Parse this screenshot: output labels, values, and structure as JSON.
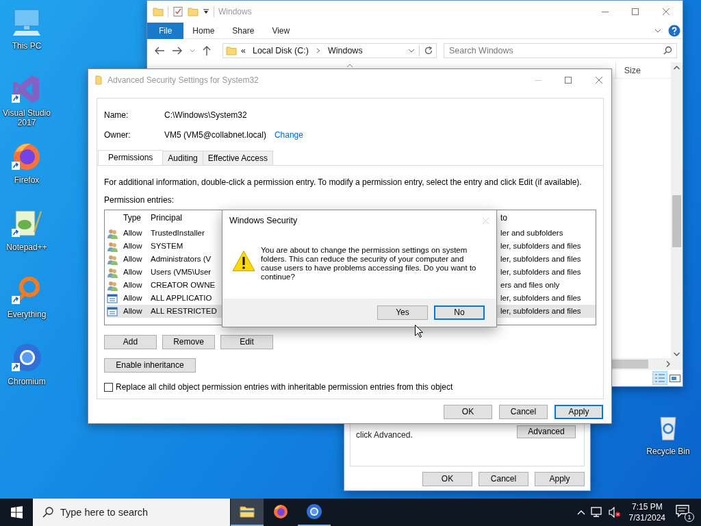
{
  "desktop_icons": [
    {
      "kind": "pc",
      "label": "This PC",
      "shortcut": false
    },
    {
      "kind": "vs",
      "label": "Visual Studio 2017",
      "shortcut": true
    },
    {
      "kind": "firefox",
      "label": "Firefox",
      "shortcut": true
    },
    {
      "kind": "notepad",
      "label": "Notepad++",
      "shortcut": true
    },
    {
      "kind": "everything",
      "label": "Everything",
      "shortcut": true
    },
    {
      "kind": "chromium",
      "label": "Chromium",
      "shortcut": true
    }
  ],
  "recycle_bin": {
    "label": "Recycle Bin"
  },
  "explorer": {
    "title": "Windows",
    "ribbon_tabs": [
      {
        "label": "File",
        "selected": true
      },
      {
        "label": "Home",
        "selected": false
      },
      {
        "label": "Share",
        "selected": false
      },
      {
        "label": "View",
        "selected": false
      }
    ],
    "address": {
      "overflow": "«",
      "crumbs": [
        "Local Disk (C:)",
        "Windows"
      ]
    },
    "search": {
      "placeholder": "Search Windows"
    },
    "columns": [
      "Size"
    ]
  },
  "properties_window": {
    "note": "click Advanced.",
    "advanced_button": "Advanced",
    "buttons": [
      "OK",
      "Cancel",
      "Apply"
    ]
  },
  "advanced_window": {
    "title": "Advanced Security Settings for System32",
    "name_label": "Name:",
    "name": "C:\\Windows\\System32",
    "owner_label": "Owner:",
    "owner": "VM5 (VM5@collabnet.local)",
    "owner_link": "Change",
    "tabs": [
      {
        "label": "Permissions",
        "selected": true
      },
      {
        "label": "Auditing",
        "selected": false
      },
      {
        "label": "Effective Access",
        "selected": false
      }
    ],
    "info": "For additional information, double-click a permission entry. To modify a permission entry, select the entry and click Edit (if available).",
    "entries_label": "Permission entries:",
    "columns": [
      "Type",
      "Principal",
      "to"
    ],
    "rows": [
      {
        "kind": "user",
        "type": "Allow",
        "principal": "TrustedInstaller",
        "applies_to": "ler and subfolders",
        "selected": false
      },
      {
        "kind": "user",
        "type": "Allow",
        "principal": "SYSTEM",
        "applies_to": "ler, subfolders and files",
        "selected": false
      },
      {
        "kind": "user",
        "type": "Allow",
        "principal": "Administrators (V",
        "applies_to": "ler, subfolders and files",
        "selected": false
      },
      {
        "kind": "user",
        "type": "Allow",
        "principal": "Users (VM5\\User",
        "applies_to": "ler, subfolders and files",
        "selected": false
      },
      {
        "kind": "user",
        "type": "Allow",
        "principal": "CREATOR OWNE",
        "applies_to": "ers and files only",
        "selected": false
      },
      {
        "kind": "package",
        "type": "Allow",
        "principal": "ALL APPLICATIO",
        "applies_to": "ler, subfolders and files",
        "selected": false
      },
      {
        "kind": "package",
        "type": "Allow",
        "principal": "ALL RESTRICTED",
        "applies_to": "ler, subfolders and files",
        "selected": true
      }
    ],
    "entry_buttons": [
      "Add",
      "Remove",
      "Edit"
    ],
    "inheritance_button": "Enable inheritance",
    "replace_checkbox": {
      "label": "Replace all child object permission entries with inheritable permission entries from this object",
      "checked": false
    },
    "buttons": [
      {
        "label": "OK",
        "default": false
      },
      {
        "label": "Cancel",
        "default": false
      },
      {
        "label": "Apply",
        "default": true
      }
    ]
  },
  "security_dialog": {
    "title": "Windows Security",
    "message": "You are about to change the permission settings on system folders. This can reduce the security of your computer and cause users to have problems accessing files. Do you want to continue?",
    "buttons": [
      {
        "label": "Yes",
        "default": false
      },
      {
        "label": "No",
        "default": true
      }
    ]
  },
  "taskbar": {
    "search_placeholder": "Type here to search",
    "apps": [
      {
        "kind": "explorer",
        "active": true,
        "running": true
      },
      {
        "kind": "firefox",
        "active": false,
        "running": false
      },
      {
        "kind": "chromium",
        "active": false,
        "running": true
      }
    ],
    "time": "7:15 PM",
    "date": "7/31/2024",
    "notifications": "1"
  }
}
